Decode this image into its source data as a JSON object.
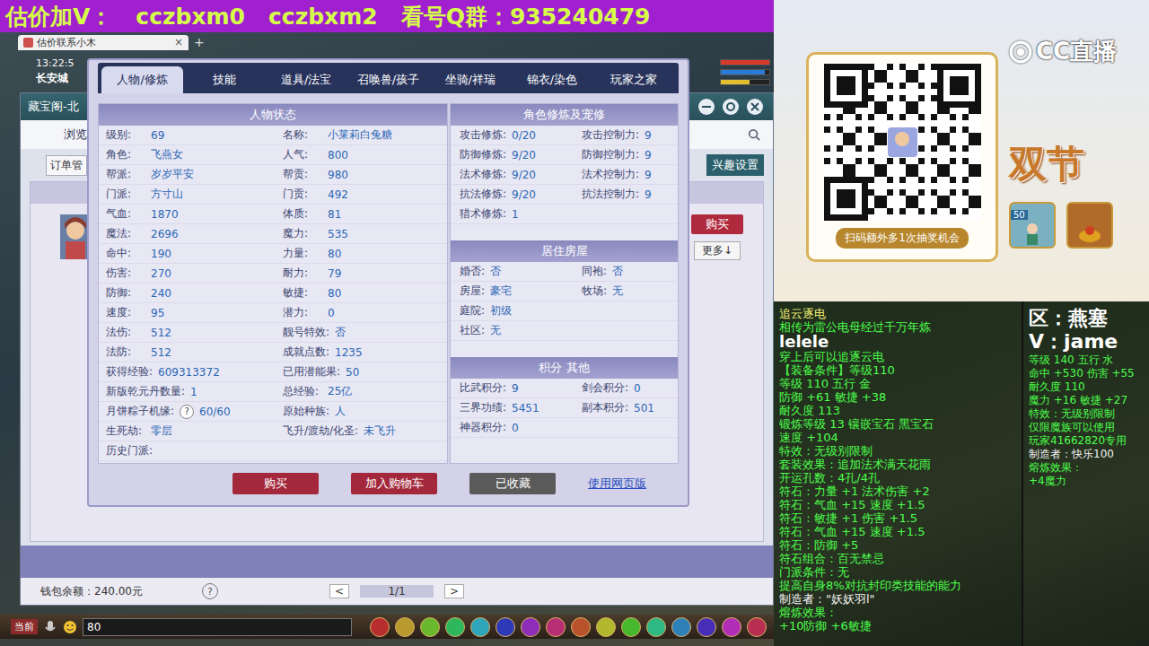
{
  "banner": {
    "segments": [
      "估价加V：",
      "cczbxm0",
      "cczbxm2",
      "看号Q群：935240479"
    ]
  },
  "browser_tab": {
    "title": "估价联系小木",
    "close": "×",
    "new_tab": "+"
  },
  "hud": {
    "time": "13:22:5",
    "location": "长安城",
    "bars": [
      {
        "level": 1,
        "color": "#d83a2a"
      },
      {
        "level": 0.9,
        "color": "#2a7ad8"
      },
      {
        "level": 0.6,
        "color": "#e0c030"
      }
    ]
  },
  "shop": {
    "title": "藏宝阁-北",
    "nav": "浏览",
    "orders": "订单管",
    "interest": "兴趣设置",
    "buy": "购买",
    "more": "更多↓",
    "wallet": "钱包余额：240.00元",
    "help": "?",
    "pager": {
      "prev": "<",
      "page": "1/1",
      "next": ">"
    }
  },
  "dialog": {
    "tabs": [
      {
        "label": "人物/修炼",
        "selected": true
      },
      {
        "label": "技能",
        "selected": false
      },
      {
        "label": "道具/法宝",
        "selected": false
      },
      {
        "label": "召唤兽/孩子",
        "selected": false
      },
      {
        "label": "坐骑/祥瑞",
        "selected": false
      },
      {
        "label": "锦衣/染色",
        "selected": false
      },
      {
        "label": "玩家之家",
        "selected": false
      }
    ],
    "status": {
      "title": "人物状态",
      "rows": [
        [
          {
            "label": "级别:",
            "value": "69"
          },
          {
            "label": "名称:",
            "value": "小莱莉白兔糖"
          }
        ],
        [
          {
            "label": "角色:",
            "value": "飞燕女"
          },
          {
            "label": "人气:",
            "value": "800"
          }
        ],
        [
          {
            "label": "帮派:",
            "value": "岁岁平安"
          },
          {
            "label": "帮贡:",
            "value": "980"
          }
        ],
        [
          {
            "label": "门派:",
            "value": "方寸山"
          },
          {
            "label": "门贡:",
            "value": "492"
          }
        ],
        [
          {
            "label": "气血:",
            "value": "1870"
          },
          {
            "label": "体质:",
            "value": "81"
          }
        ],
        [
          {
            "label": "魔法:",
            "value": "2696"
          },
          {
            "label": "魔力:",
            "value": "535"
          }
        ],
        [
          {
            "label": "命中:",
            "value": "190"
          },
          {
            "label": "力量:",
            "value": "80"
          }
        ],
        [
          {
            "label": "伤害:",
            "value": "270"
          },
          {
            "label": "耐力:",
            "value": "79"
          }
        ],
        [
          {
            "label": "防御:",
            "value": "240"
          },
          {
            "label": "敏捷:",
            "value": "80"
          }
        ],
        [
          {
            "label": "速度:",
            "value": "95"
          },
          {
            "label": "潜力:",
            "value": "0"
          }
        ],
        [
          {
            "label": "法伤:",
            "value": "512"
          },
          {
            "label": "靓号特效:",
            "value": "否"
          }
        ],
        [
          {
            "label": "法防:",
            "value": "512"
          },
          {
            "label": "成就点数:",
            "value": "1235"
          }
        ],
        [
          {
            "label": "获得经验:",
            "value": "609313372"
          },
          {
            "label": "已用潜能果:",
            "value": "50"
          }
        ],
        [
          {
            "label": "新版乾元丹数量:",
            "value": "1"
          },
          {
            "label": "总经验:",
            "value": "25亿"
          }
        ],
        [
          {
            "label": "月饼粽子机缘:",
            "hint": "?",
            "value": "60/60"
          },
          {
            "label": "原始种族:",
            "value": "人"
          }
        ],
        [
          {
            "label": "生死劫:",
            "value": "零层"
          },
          {
            "label": "飞升/渡劫/化圣:",
            "value": "未飞升"
          }
        ],
        [
          {
            "label": "历史门派:",
            "value": ""
          }
        ]
      ]
    },
    "sections": [
      {
        "title": "角色修炼及宠修",
        "rows": [
          [
            {
              "label": "攻击修炼:",
              "value": "0/20"
            },
            {
              "label": "攻击控制力:",
              "value": "9"
            }
          ],
          [
            {
              "label": "防御修炼:",
              "value": "9/20"
            },
            {
              "label": "防御控制力:",
              "value": "9"
            }
          ],
          [
            {
              "label": "法术修炼:",
              "value": "9/20"
            },
            {
              "label": "法术控制力:",
              "value": "9"
            }
          ],
          [
            {
              "label": "抗法修炼:",
              "value": "9/20"
            },
            {
              "label": "抗法控制力:",
              "value": "9"
            }
          ],
          [
            {
              "label": "猎术修炼:",
              "value": "1"
            }
          ]
        ]
      },
      {
        "title": "居住房屋",
        "rows": [
          [
            {
              "label": "婚否:",
              "value": "否"
            },
            {
              "label": "同袍:",
              "value": "否"
            }
          ],
          [
            {
              "label": "房屋:",
              "value": "豪宅"
            },
            {
              "label": "牧场:",
              "value": "无"
            }
          ],
          [
            {
              "label": "庭院:",
              "value": "初级"
            }
          ],
          [
            {
              "label": "社区:",
              "value": "无"
            }
          ]
        ]
      },
      {
        "title": "积分 其他",
        "rows": [
          [
            {
              "label": "比武积分:",
              "value": "9"
            },
            {
              "label": "剑会积分:",
              "value": "0"
            }
          ],
          [
            {
              "label": "三界功绩:",
              "value": "5451"
            },
            {
              "label": "副本积分:",
              "value": "501"
            }
          ],
          [
            {
              "label": "神器积分:",
              "value": "0"
            }
          ]
        ]
      }
    ],
    "buttons": [
      {
        "label": "购买",
        "kind": "red"
      },
      {
        "label": "加入购物车",
        "kind": "red"
      },
      {
        "label": "已收藏",
        "kind": "grey"
      },
      {
        "label": "使用网页版",
        "kind": "link"
      }
    ]
  },
  "chat_bar": {
    "channel": "当前",
    "input": "80"
  },
  "stream": {
    "logo": "CC直播",
    "qr_caption": "扫码额外多1次抽奖机会",
    "promo": "双节",
    "badge": "50"
  },
  "tooltips": [
    {
      "lines": [
        {
          "kind": "title",
          "text": "追云逐电"
        },
        {
          "kind": "line",
          "text": "相传为雷公电母经过千万年炼"
        },
        {
          "kind": "mark",
          "text": "lelele"
        },
        {
          "kind": "line",
          "text": "穿上后可以追逐云电"
        },
        {
          "kind": "line",
          "text": "【装备条件】等级110"
        },
        {
          "kind": "line",
          "text": "等级 110  五行 金"
        },
        {
          "kind": "line",
          "text": "防御 +61 敏捷 +38"
        },
        {
          "kind": "line",
          "text": "耐久度 113"
        },
        {
          "kind": "line",
          "text": "锻炼等级 13 镶嵌宝石 黑宝石"
        },
        {
          "kind": "line",
          "text": "速度 +104"
        },
        {
          "kind": "line",
          "text": "特效：无级别限制"
        },
        {
          "kind": "line",
          "text": "套装效果：追加法术满天花雨"
        },
        {
          "kind": "line",
          "text": "开运孔数：4孔/4孔"
        },
        {
          "kind": "line",
          "text": "符石：力量 +1 法术伤害 +2"
        },
        {
          "kind": "line",
          "text": "符石：气血 +15 速度 +1.5"
        },
        {
          "kind": "line",
          "text": "符石：敏捷 +1 伤害 +1.5"
        },
        {
          "kind": "line",
          "text": "符石：气血 +15 速度 +1.5"
        },
        {
          "kind": "line",
          "text": "符石：防御 +5"
        },
        {
          "kind": "line",
          "text": "符石组合：百无禁忌"
        },
        {
          "kind": "line",
          "text": "门派条件：无"
        },
        {
          "kind": "line",
          "text": "提高自身8%对抗封印类技能的能力"
        },
        {
          "kind": "maker",
          "text": "制造者：\"妖妖羽l\""
        },
        {
          "kind": "line",
          "text": "熔炼效果："
        },
        {
          "kind": "line",
          "text": "+10防御 +6敏捷"
        }
      ]
    },
    {
      "lines": [
        {
          "kind": "big",
          "text": "区：燕塞"
        },
        {
          "kind": "big",
          "text": "V：jame"
        },
        {
          "kind": "line",
          "text": "等级 140 五行 水"
        },
        {
          "kind": "line",
          "text": "命中 +530 伤害 +55"
        },
        {
          "kind": "line",
          "text": "耐久度 110"
        },
        {
          "kind": "line",
          "text": "魔力 +16 敏捷 +27"
        },
        {
          "kind": "line",
          "text": "特效：无级别限制"
        },
        {
          "kind": "line",
          "text": "仅限魔族可以使用"
        },
        {
          "kind": "line",
          "text": "玩家41662820专用"
        },
        {
          "kind": "maker",
          "text": "制造者：快乐100"
        },
        {
          "kind": "line",
          "text": "熔炼效果："
        },
        {
          "kind": "line",
          "text": "+4魔力"
        }
      ]
    }
  ]
}
